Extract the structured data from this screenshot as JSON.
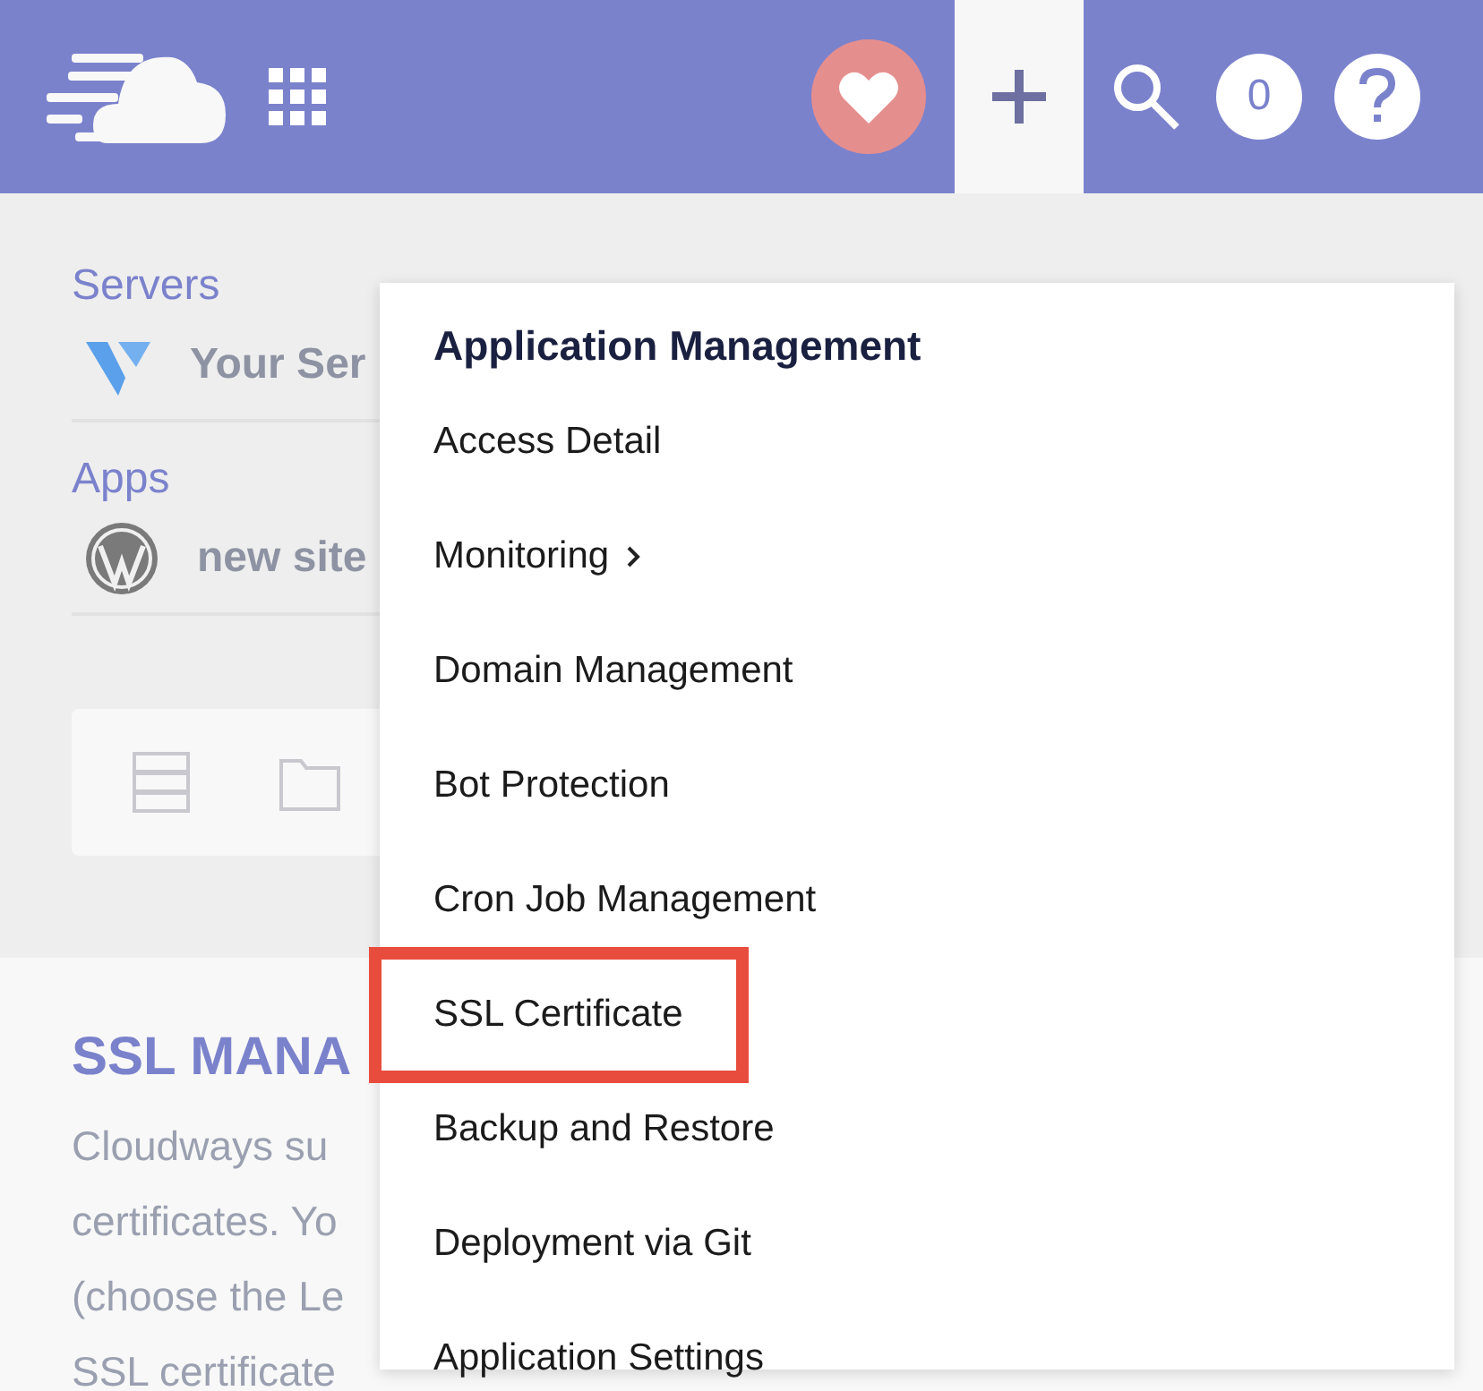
{
  "header": {
    "notification_count": "0"
  },
  "sidebar": {
    "sections": [
      {
        "title": "Servers",
        "items": [
          {
            "label": "Your Ser",
            "kind": "server"
          }
        ]
      },
      {
        "title": "Apps",
        "items": [
          {
            "label": "new site",
            "kind": "wordpress"
          }
        ]
      }
    ]
  },
  "ssl_section": {
    "title": "SSL MANA",
    "lines": [
      "Cloudways su",
      "certificates. Yo",
      "(choose the Le",
      "SSL certificate"
    ]
  },
  "menu": {
    "title": "Application Management",
    "items": [
      {
        "label": "Access Detail",
        "submenu": false,
        "highlighted": false
      },
      {
        "label": "Monitoring",
        "submenu": true,
        "highlighted": false
      },
      {
        "label": "Domain Management",
        "submenu": false,
        "highlighted": false
      },
      {
        "label": "Bot Protection",
        "submenu": false,
        "highlighted": false
      },
      {
        "label": "Cron Job Management",
        "submenu": false,
        "highlighted": false
      },
      {
        "label": "SSL Certificate",
        "submenu": false,
        "highlighted": true
      },
      {
        "label": "Backup and Restore",
        "submenu": false,
        "highlighted": false
      },
      {
        "label": "Deployment via Git",
        "submenu": false,
        "highlighted": false
      },
      {
        "label": "Application Settings",
        "submenu": false,
        "highlighted": false
      }
    ]
  }
}
